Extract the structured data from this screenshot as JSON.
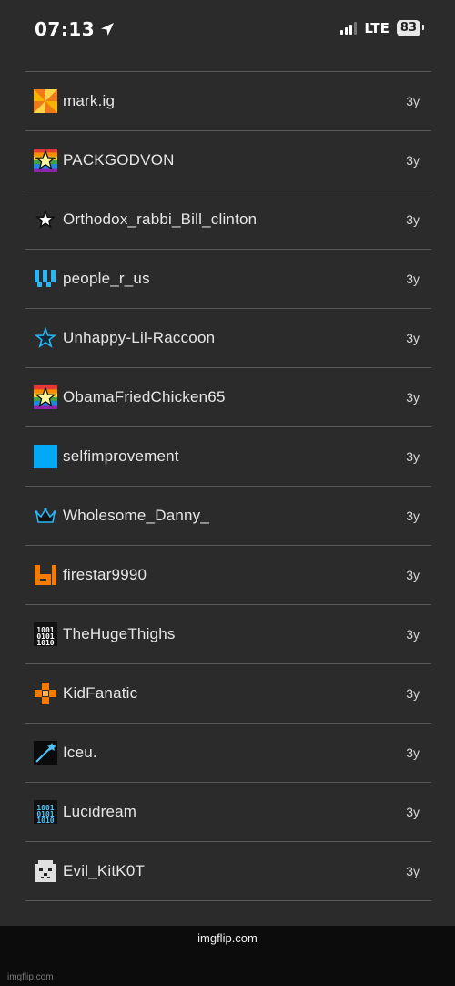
{
  "status_bar": {
    "time": "07:13",
    "network": "LTE",
    "battery": "83"
  },
  "users": [
    {
      "name": "mark.ig",
      "age": "3y",
      "icon": "pinwheel-icon"
    },
    {
      "name": "PACKGODVON",
      "age": "3y",
      "icon": "rainbow-star-icon"
    },
    {
      "name": "Orthodox_rabbi_Bill_clinton",
      "age": "3y",
      "icon": "outline-star-icon"
    },
    {
      "name": "people_r_us",
      "age": "3y",
      "icon": "blue-bars-icon"
    },
    {
      "name": "Unhappy-Lil-Raccoon",
      "age": "3y",
      "icon": "blue-star-icon"
    },
    {
      "name": "ObamaFriedChicken65",
      "age": "3y",
      "icon": "rainbow-star-icon"
    },
    {
      "name": "selfimprovement",
      "age": "3y",
      "icon": "blue-square-icon"
    },
    {
      "name": "Wholesome_Danny_",
      "age": "3y",
      "icon": "crown-icon"
    },
    {
      "name": "firestar9990",
      "age": "3y",
      "icon": "orange-block-icon"
    },
    {
      "name": "TheHugeThighs",
      "age": "3y",
      "icon": "binary-icon"
    },
    {
      "name": "KidFanatic",
      "age": "3y",
      "icon": "orange-checker-icon"
    },
    {
      "name": "Iceu.",
      "age": "3y",
      "icon": "shooting-star-icon"
    },
    {
      "name": "Lucidream",
      "age": "3y",
      "icon": "blue-binary-icon"
    },
    {
      "name": "Evil_KitK0T",
      "age": "3y",
      "icon": "cat-face-icon"
    }
  ],
  "footer": {
    "brand": "imgflip.com",
    "watermark": "imgflip.com"
  },
  "colors": {
    "background": "#2b2b2b",
    "divider": "#5a5a5a",
    "footer": "#0c0c0c"
  }
}
